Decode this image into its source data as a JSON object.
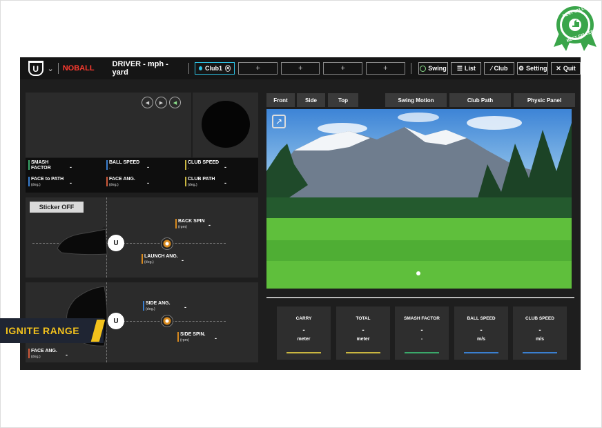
{
  "badge": {
    "text_top": "BEST SELLER",
    "text_bottom": "BEST SELLER",
    "color": "#3aa54a"
  },
  "topbar": {
    "noball": "NOBALL",
    "title": "DRIVER - mph - yard",
    "club_active": "Club1",
    "add_slot": "+",
    "buttons": {
      "swing": "Swing",
      "list": "List",
      "club": "Club",
      "setting": "Setting",
      "quit": "Quit"
    }
  },
  "metrics": {
    "smash_factor": "SMASH",
    "smash_factor_2": "FACTOR",
    "ball_speed": "BALL SPEED",
    "club_speed": "CLUB SPEED",
    "face_to_path": "FACE to PATH",
    "face_ang": "FACE ANG.",
    "club_path": "CLUB PATH",
    "deg": "(deg.)",
    "dash": "-"
  },
  "side_view": {
    "sticker": "Sticker OFF",
    "back_spin": "BACK SPIN",
    "rpm": "(rpm)",
    "launch_ang": "LAUNCH ANG.",
    "deg": "(deg.)",
    "dash": "-"
  },
  "top_view": {
    "side_ang": "SIDE ANG.",
    "side_spin": "SIDE SPIN.",
    "face_ang": "FACE ANG.",
    "deg": "(deg.)",
    "rpm": "(rpm)",
    "dash": "-"
  },
  "overlay_banner": "IGNITE RANGE",
  "view_tabs": {
    "front": "Front",
    "side": "Side",
    "top": "Top",
    "swing_motion": "Swing Motion",
    "club_path": "Club Path",
    "physic_panel": "Physic Panel"
  },
  "cards": [
    {
      "label": "CARRY",
      "value": "-",
      "unit": "meter",
      "color": "#c9b640"
    },
    {
      "label": "TOTAL",
      "value": "-",
      "unit": "meter",
      "color": "#c9b640"
    },
    {
      "label": "SMASH FACTOR",
      "value": "-",
      "unit": "-",
      "color": "#3aa86a"
    },
    {
      "label": "BALL SPEED",
      "value": "-",
      "unit": "m/s",
      "color": "#3a7fd0"
    },
    {
      "label": "CLUB SPEED",
      "value": "-",
      "unit": "m/s",
      "color": "#3a7fd0"
    }
  ],
  "colors": {
    "accent_cyan": "#2ec4e6",
    "noball_red": "#ff3b2f",
    "banner_yellow": "#f3c21c"
  }
}
